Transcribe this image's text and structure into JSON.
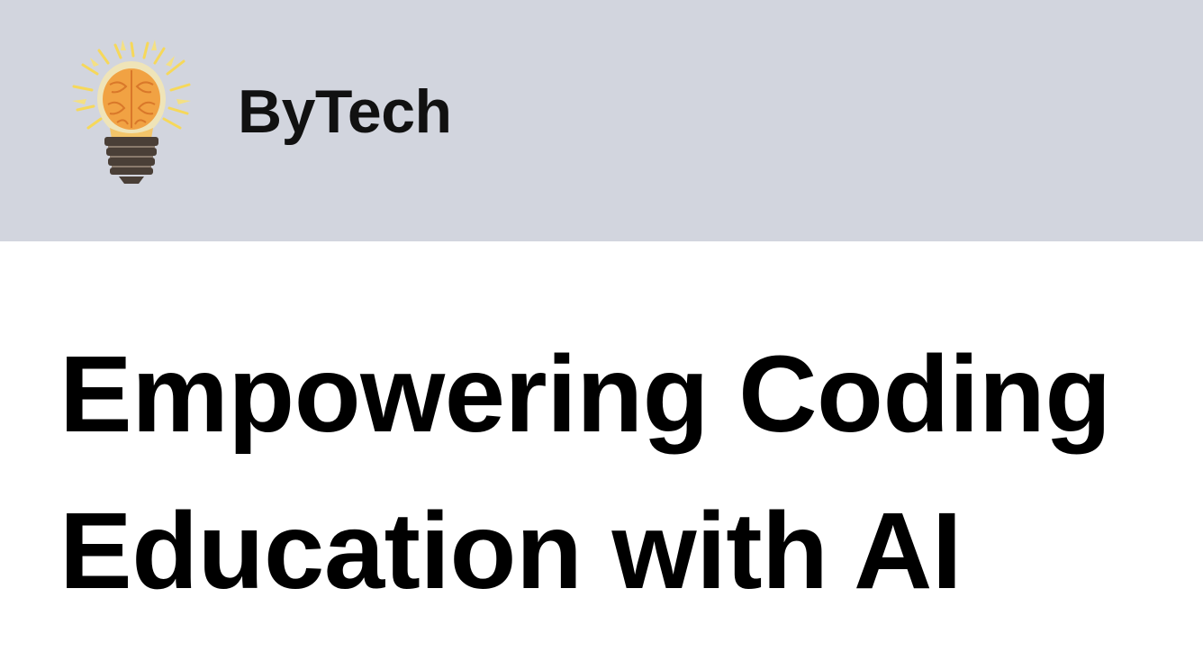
{
  "header": {
    "brand": "ByTech",
    "logo_icon": "lightbulb-brain-icon",
    "background": "#d2d5de"
  },
  "hero": {
    "line1": "Empowering Coding",
    "line2": "Education with AI"
  },
  "colors": {
    "text": "#000000",
    "bulb_glow": "#f6d85a",
    "brain": "#f1a243",
    "base": "#4a3f37"
  }
}
